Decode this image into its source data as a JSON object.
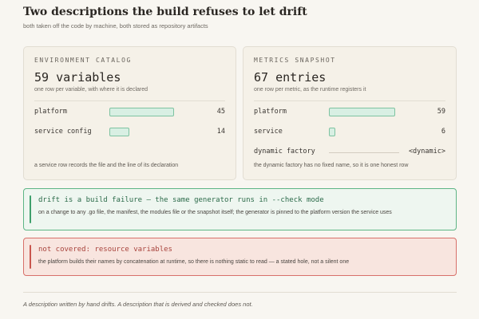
{
  "header": {
    "title": "Two descriptions the build refuses to let drift",
    "subtitle": "both taken off the code by machine, both stored as repository artifacts"
  },
  "environment_catalog": {
    "caption": "ENVIRONMENT CATALOG",
    "count_text": "59 variables",
    "description": "one row per variable, with where it is declared",
    "rows": [
      {
        "label": "platform",
        "count": "45",
        "share": 0.76
      },
      {
        "label": "service config",
        "count": "14",
        "share": 0.24
      }
    ],
    "footer": "a service row records the file and the line of its declaration"
  },
  "metrics_snapshot": {
    "caption": "METRICS SNAPSHOT",
    "count_text": "67 entries",
    "description": "one row per metric, as the runtime registers it",
    "rows": [
      {
        "label": "platform",
        "count": "59",
        "share": 0.88
      },
      {
        "label": "service",
        "count": "6",
        "share": 0.09
      },
      {
        "label": "dynamic factory",
        "count": "<dynamic>"
      }
    ],
    "footer": "the dynamic factory has no fixed name, so it is one honest row"
  },
  "callouts": {
    "drift": {
      "heading": "drift is a build failure – the same generator runs in --check mode",
      "body": "on a change to any .go file, the manifest, the modules file or the snapshot itself; the generator is pinned to the platform version the service uses",
      "color": "#3e9f6c"
    },
    "not_covered": {
      "heading": "not covered: resource variables",
      "body": "the platform builds their names by concatenation at runtime, so there is nothing static to read — a stated hole, not a silent one",
      "color": "#c9564e"
    }
  },
  "footnote": "A description written by hand drifts. A description that is derived and checked does not.",
  "colors": {
    "bar_fill": "#d8efe3",
    "bar_border": "#7ec3a1",
    "success": "#3e9f6c",
    "danger": "#c9564e"
  }
}
